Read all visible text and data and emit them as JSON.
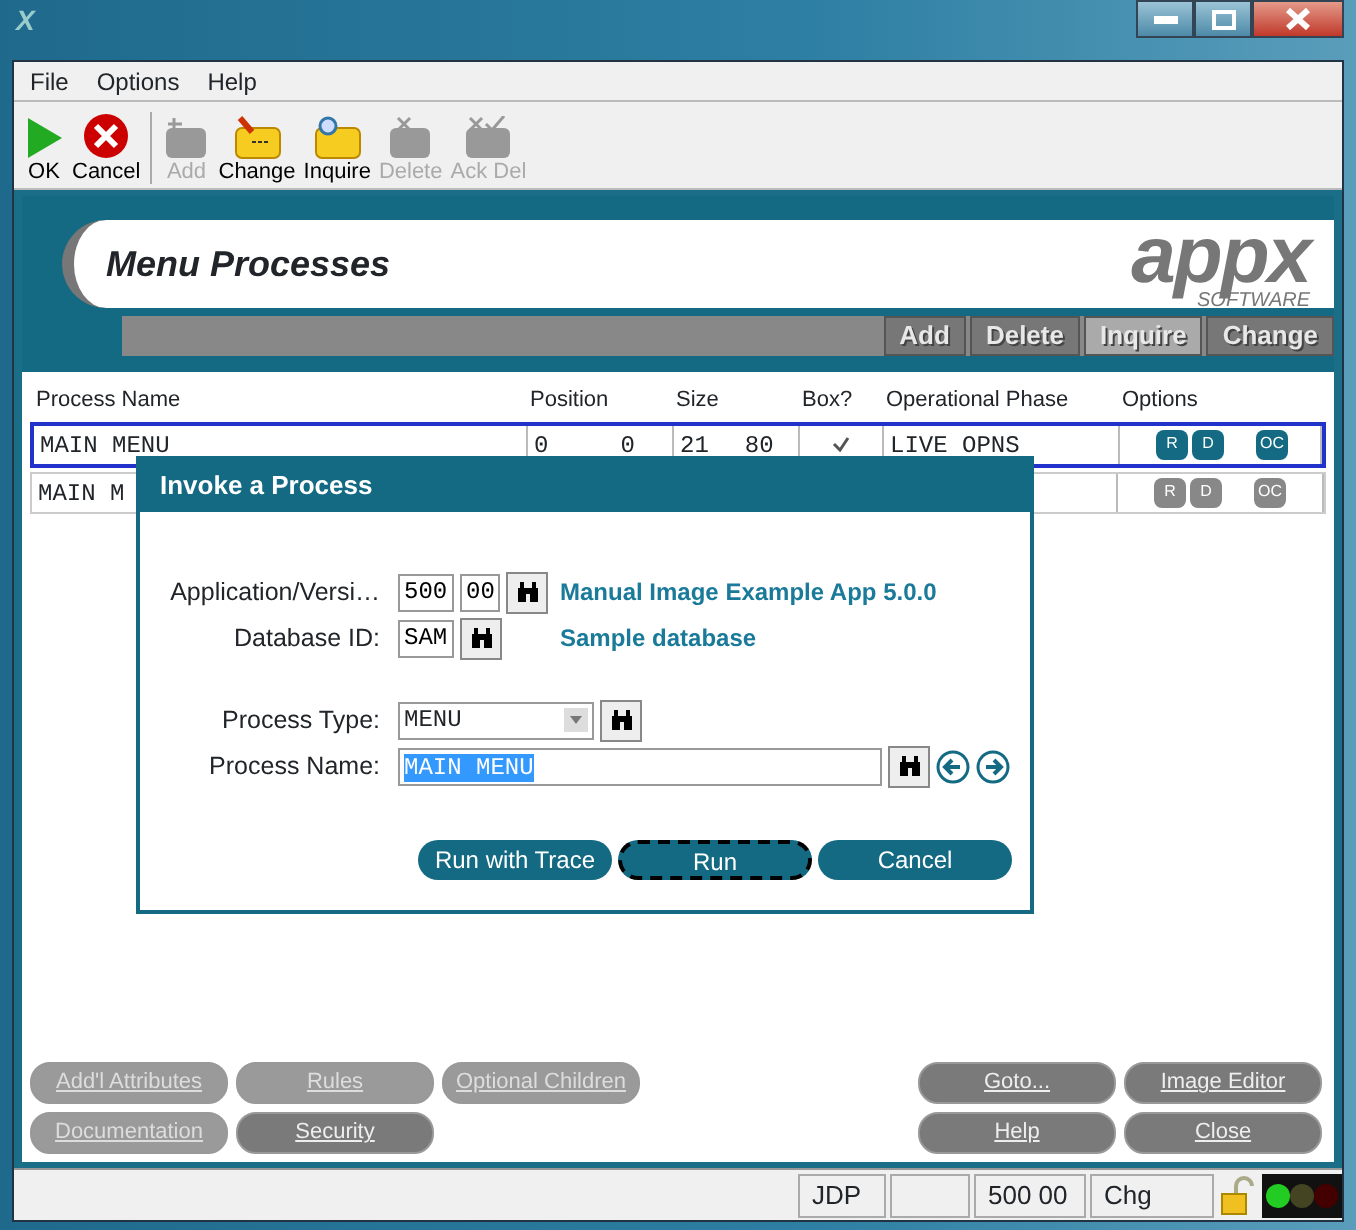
{
  "window": {
    "logo": "X"
  },
  "menu": [
    "File",
    "Options",
    "Help"
  ],
  "toolbar": [
    {
      "label": "OK",
      "kind": "ok",
      "disabled": false
    },
    {
      "label": "Cancel",
      "kind": "cancel",
      "disabled": false
    },
    {
      "label": "Add",
      "kind": "add",
      "disabled": true
    },
    {
      "label": "Change",
      "kind": "change",
      "disabled": false
    },
    {
      "label": "Inquire",
      "kind": "inquire",
      "disabled": false
    },
    {
      "label": "Delete",
      "kind": "delete",
      "disabled": true
    },
    {
      "label": "Ack Del",
      "kind": "ackdel",
      "disabled": true
    }
  ],
  "header": {
    "title": "Menu Processes",
    "logo": "appx",
    "logo_sub": "SOFTWARE"
  },
  "tabs": [
    {
      "label": "Add",
      "selected": false
    },
    {
      "label": "Delete",
      "selected": false
    },
    {
      "label": "Inquire",
      "selected": true
    },
    {
      "label": "Change",
      "selected": false
    }
  ],
  "table": {
    "columns": [
      "Process Name",
      "Position",
      "Size",
      "Box?",
      "Operational Phase",
      "Options"
    ],
    "rows": [
      {
        "name": "MAIN MENU",
        "pos_row": "0",
        "pos_col": "0",
        "size_rows": "21",
        "size_cols": "80",
        "box": true,
        "phase": "LIVE OPNS",
        "options": [
          "R",
          "D",
          "OC"
        ],
        "selected": true
      },
      {
        "name": "MAIN M",
        "options": [
          "R",
          "D",
          "OC"
        ],
        "selected": false
      }
    ]
  },
  "dialog": {
    "title": "Invoke a Process",
    "app_label": "Application/Versi…",
    "app": "500",
    "version": "00",
    "app_desc": "Manual Image Example App 5.0.0",
    "db_label": "Database ID:",
    "db": "SAM",
    "db_desc": "Sample database",
    "type_label": "Process Type:",
    "type": "MENU",
    "name_label": "Process Name:",
    "name": "MAIN MENU",
    "buttons": [
      {
        "label": "Run with Trace",
        "focused": false
      },
      {
        "label": "Run",
        "focused": true
      },
      {
        "label": "Cancel",
        "focused": false
      }
    ]
  },
  "bottom_left": [
    [
      {
        "label": "Add'l Attributes",
        "disabled": true
      },
      {
        "label": "Rules",
        "disabled": true
      },
      {
        "label": "Optional Children",
        "disabled": true
      }
    ],
    [
      {
        "label": "Documentation",
        "disabled": true
      },
      {
        "label": "Security",
        "disabled": false
      }
    ]
  ],
  "bottom_right": [
    [
      {
        "label": "Goto...",
        "disabled": false
      },
      {
        "label": "Image Editor",
        "disabled": false
      }
    ],
    [
      {
        "label": "Help",
        "disabled": false
      },
      {
        "label": "Close",
        "disabled": false
      }
    ]
  ],
  "status_bar": [
    "JDP",
    "500 00",
    "Chg"
  ]
}
